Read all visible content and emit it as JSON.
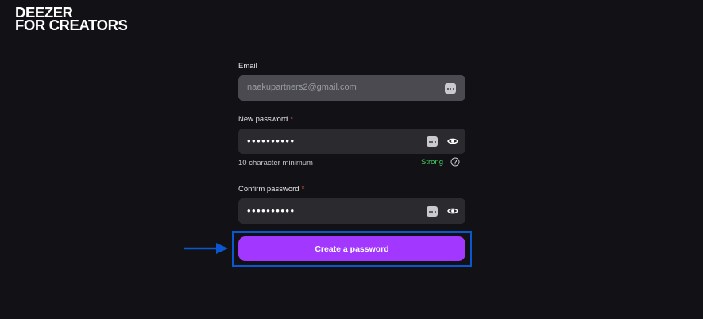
{
  "brand": {
    "line1": "DEEZER",
    "line2": "FOR CREATORS"
  },
  "form": {
    "email": {
      "label": "Email",
      "value": "naekupartners2@gmail.com",
      "icon": "password-manager-icon"
    },
    "new_password": {
      "label": "New password",
      "required_mark": "*",
      "value_masked": "••••••••••",
      "hint": "10 character minimum",
      "strength": "Strong",
      "icons": [
        "password-manager-icon",
        "eye-icon",
        "help-icon"
      ]
    },
    "confirm_password": {
      "label": "Confirm password",
      "required_mark": "*",
      "value_masked": "••••••••••",
      "icons": [
        "password-manager-icon",
        "eye-icon"
      ]
    },
    "submit_label": "Create a password"
  },
  "annotation": {
    "highlight_color": "#0b57d0",
    "arrow_icon": "arrow-right-icon"
  },
  "colors": {
    "background": "#121216",
    "field": "#2a2a2f",
    "accent": "#a238ff",
    "strength_ok": "#3fcf63",
    "required": "#ff5b5b"
  }
}
